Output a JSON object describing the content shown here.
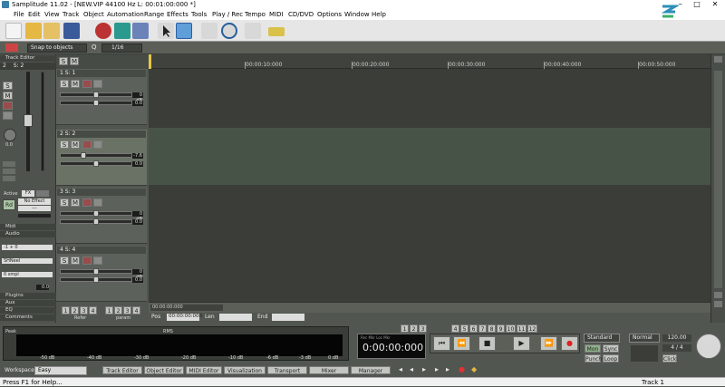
{
  "window": {
    "title": "Samplitude 11.02 - [NEW.VIP  44100 Hz L: 00:01:00:000 *]",
    "min": "—",
    "max": "□",
    "close": "✕"
  },
  "menu": [
    "File",
    "Edit",
    "View",
    "Track",
    "Object",
    "Automation",
    "Range",
    "Effects",
    "Tools",
    "Play / Rec",
    "Tempo",
    "MIDI",
    "CD/DVD",
    "Options",
    "Window",
    "Help"
  ],
  "toolbar2": {
    "snap": "Snap to objects",
    "q_label": "Q",
    "q_value": "1/16"
  },
  "left": {
    "track_editor": "Track Editor",
    "track_num": "2",
    "track_name": "S: 2",
    "s": "S",
    "m": "M",
    "vol": "0.0",
    "active": "Active",
    "mixer_tab": "FX",
    "no_effect": "No Effect",
    "dash": "---",
    "rd": "Rd",
    "midi": "Midi",
    "audio": "Audio",
    "input": "-1 + 0",
    "output": "SHNeel",
    "setting": "0 smpl",
    "setting2": "0.0",
    "plugins": "Plugins",
    "aux": "Aux",
    "eq": "EQ",
    "comments": "Comments"
  },
  "tracks": [
    {
      "num": "1",
      "name": "S: 1",
      "vol": "0 dB",
      "pan": "0.0"
    },
    {
      "num": "2",
      "name": "S: 2",
      "vol": "-7.6",
      "pan": "0.0"
    },
    {
      "num": "3",
      "name": "S: 3",
      "vol": "0 dB",
      "pan": "0.0"
    },
    {
      "num": "4",
      "name": "S: 4",
      "vol": "0 dB",
      "pan": "0.0"
    }
  ],
  "track_buttons": {
    "s": "S",
    "m": "M"
  },
  "ruler": [
    "00:00:10:000",
    "00:00:20:000",
    "00:00:30:000",
    "00:00:40:000",
    "00:00:50:000"
  ],
  "ruler_start": "00:00:00:000",
  "position": {
    "pos_label": "Pos",
    "pos_value": "00:00:00:000",
    "len_label": "Len",
    "end_label": "End"
  },
  "numbers": [
    "1",
    "2",
    "3",
    "4",
    "1",
    "2",
    "3",
    "4"
  ],
  "num_labels": {
    "left": "Refer",
    "right": "param"
  },
  "meter": {
    "peak": "Peak",
    "rms": "RMS",
    "ticks": [
      "-50 dB",
      "-40 dB",
      "-30 dB",
      "-20 dB",
      "-10 dB",
      "-6 dB",
      "-3 dB",
      "0 dB"
    ]
  },
  "transport": {
    "time": "0:00:00:000",
    "label": "Rec  Mkr  Loc  Mkr",
    "standard": "Standard",
    "normal": "Normal",
    "mon": "Mon",
    "sync": "Sync",
    "punch": "Punch",
    "loop": "Loop",
    "spd": "120.00",
    "sig": "4 / 4",
    "click": "Click",
    "markers": [
      "1",
      "2",
      "3",
      "4",
      "5",
      "6",
      "7",
      "8",
      "9",
      "10",
      "11",
      "12"
    ]
  },
  "workspace": {
    "label": "Workspace",
    "value": "Easy",
    "buttons": [
      "Track Editor",
      "Object Editor",
      "MIDI Editor",
      "Visualization",
      "Transport",
      "Mixer",
      "Manager"
    ]
  },
  "status": {
    "help": "Press F1 for Help...",
    "track": "Track 1"
  }
}
